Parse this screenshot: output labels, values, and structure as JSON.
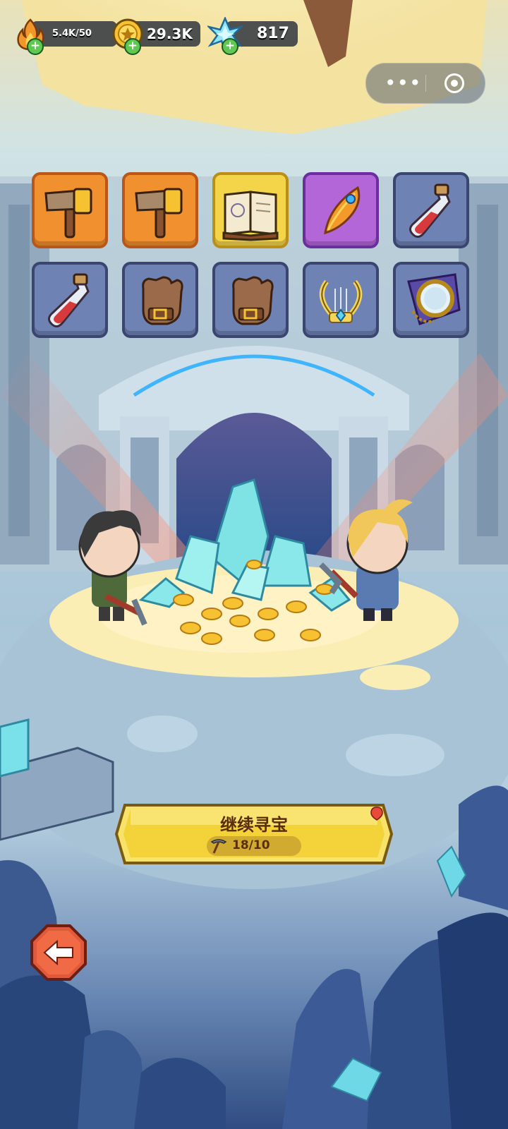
{
  "hud": {
    "energy": {
      "value": "5.4K/50",
      "icon": "flame-icon"
    },
    "coins": {
      "value": "29.3K",
      "icon": "coin-icon"
    },
    "gems": {
      "value": "817",
      "icon": "crystal-icon"
    }
  },
  "capsule": {
    "menu_icon": "more-dots-icon",
    "close_icon": "target-close-icon"
  },
  "items": [
    {
      "name": "hammer",
      "rarity": "orange",
      "icon": "hammer-icon"
    },
    {
      "name": "hammer",
      "rarity": "orange",
      "icon": "hammer-icon"
    },
    {
      "name": "spellbook",
      "rarity": "yellow",
      "icon": "book-icon"
    },
    {
      "name": "phoenix-feather",
      "rarity": "purple",
      "icon": "feather-icon"
    },
    {
      "name": "red-potion",
      "rarity": "blue",
      "icon": "potion-icon"
    },
    {
      "name": "red-potion",
      "rarity": "blue",
      "icon": "potion-icon"
    },
    {
      "name": "leather-glove",
      "rarity": "blue",
      "icon": "glove-icon"
    },
    {
      "name": "leather-glove",
      "rarity": "blue",
      "icon": "glove-icon"
    },
    {
      "name": "lyre",
      "rarity": "blue",
      "icon": "lyre-icon"
    },
    {
      "name": "pocket-watch",
      "rarity": "blue",
      "icon": "pocket-watch-icon"
    }
  ],
  "main_button": {
    "label": "继续寻宝",
    "progress_text": "18/10",
    "progress_icon": "pickaxe-icon",
    "badge_icon": "red-dot-icon"
  },
  "back_button": {
    "icon": "back-arrow-icon"
  },
  "colors": {
    "gold": "#f4d54a",
    "orange": "#f0902e",
    "purple": "#b266d8",
    "blue": "#6f82b4"
  }
}
